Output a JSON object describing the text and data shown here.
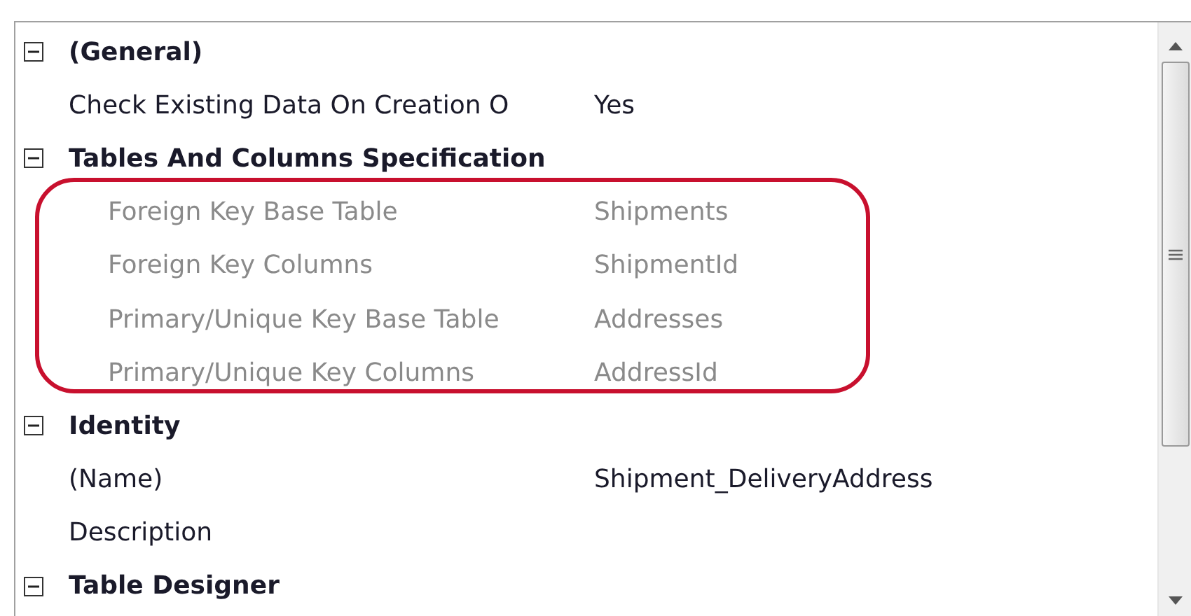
{
  "properties": [
    {
      "kind": "category",
      "label": "(General)",
      "expanded": true,
      "children": [
        {
          "kind": "property",
          "label": "Check Existing Data On Creation O",
          "value": "Yes",
          "disabled": false
        }
      ]
    },
    {
      "kind": "category",
      "label": "Tables And Columns Specification",
      "expanded": true,
      "highlighted": true,
      "children": [
        {
          "kind": "property",
          "label": "Foreign Key Base Table",
          "value": "Shipments",
          "disabled": true
        },
        {
          "kind": "property",
          "label": "Foreign Key Columns",
          "value": "ShipmentId",
          "disabled": true
        },
        {
          "kind": "property",
          "label": "Primary/Unique Key Base Table",
          "value": "Addresses",
          "disabled": true
        },
        {
          "kind": "property",
          "label": "Primary/Unique Key Columns",
          "value": "AddressId",
          "disabled": true
        }
      ]
    },
    {
      "kind": "category",
      "label": "Identity",
      "expanded": true,
      "children": [
        {
          "kind": "property",
          "label": "(Name)",
          "value": "Shipment_DeliveryAddress",
          "disabled": false
        },
        {
          "kind": "property",
          "label": "Description",
          "disabled": false
        }
      ]
    },
    {
      "kind": "category",
      "label": "Table Designer",
      "expanded": true
    }
  ]
}
